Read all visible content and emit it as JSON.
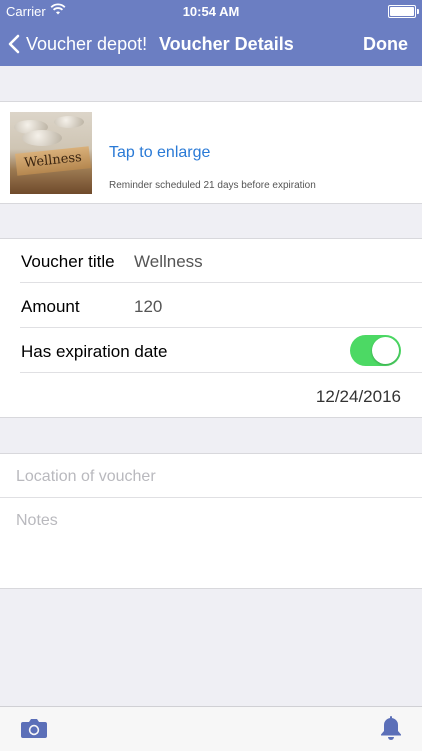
{
  "status_bar": {
    "carrier": "Carrier",
    "time": "10:54 AM"
  },
  "nav": {
    "back_label": "Voucher depot!",
    "title": "Voucher Details",
    "done_label": "Done"
  },
  "image_section": {
    "image_text": "Wellness",
    "enlarge_label": "Tap to enlarge",
    "reminder_text": "Reminder scheduled 21 days before expiration"
  },
  "form": {
    "title_label": "Voucher title",
    "title_value": "Wellness",
    "amount_label": "Amount",
    "amount_value": "120",
    "expiration_label": "Has expiration date",
    "expiration_enabled": true,
    "expiration_date": "12/24/2016"
  },
  "notes_section": {
    "location_placeholder": "Location of voucher",
    "notes_placeholder": "Notes"
  },
  "icons": {
    "back": "chevron-left-icon",
    "camera": "camera-icon",
    "bell": "bell-icon",
    "wifi": "wifi-icon",
    "battery": "battery-icon"
  },
  "colors": {
    "nav_background": "#6b7ec2",
    "accent_blue": "#2a7ad6",
    "toggle_on": "#4cd964",
    "toolbar_icon": "#5b6fb8"
  }
}
